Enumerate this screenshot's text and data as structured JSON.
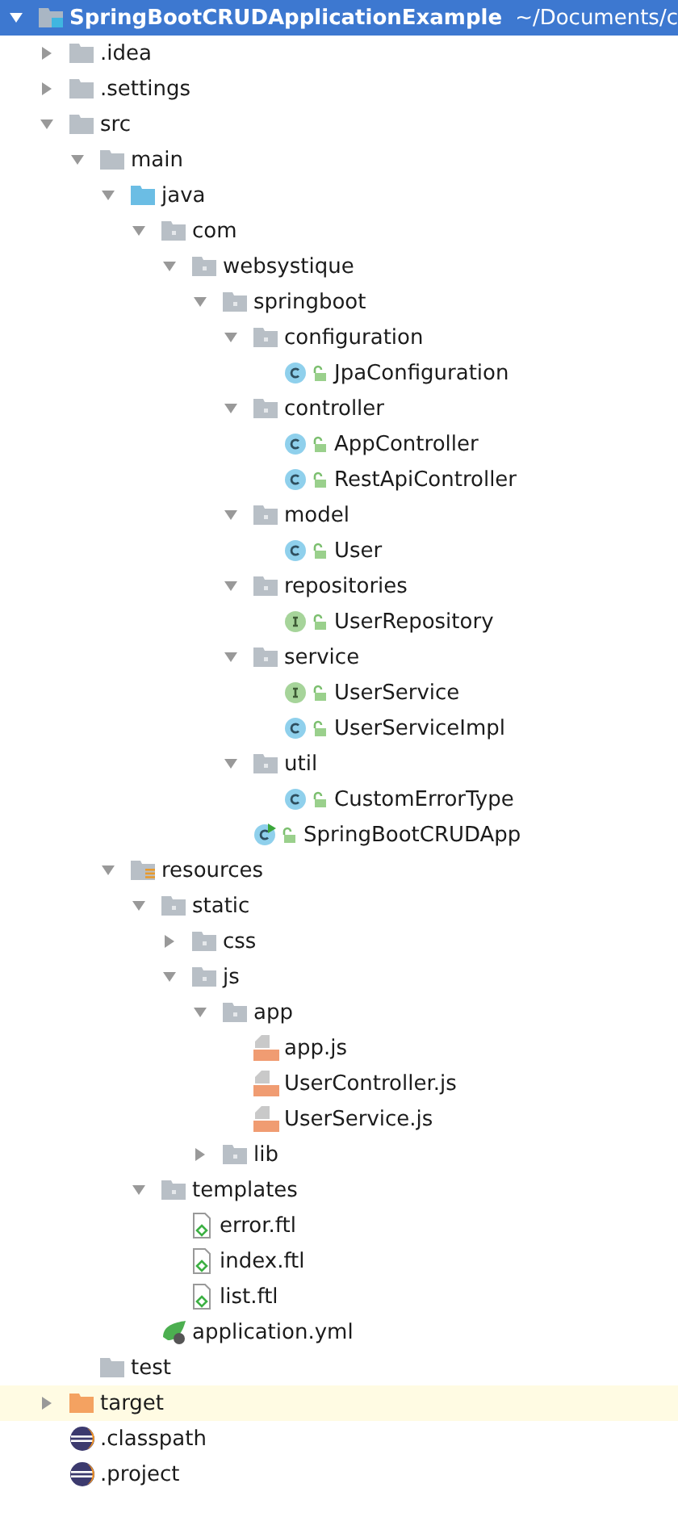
{
  "tree": [
    {
      "kind": "module",
      "name": "SpringBootCRUDApplicationExample",
      "path": "~/Documents/c",
      "selected": true,
      "expanded": true,
      "children": [
        {
          "kind": "folder",
          "name": ".idea",
          "selected": false,
          "expanded": false
        },
        {
          "kind": "folder",
          "name": ".settings",
          "selected": false,
          "expanded": false
        },
        {
          "kind": "folder",
          "name": "src",
          "selected": false,
          "expanded": true,
          "children": [
            {
              "kind": "folder",
              "name": "main",
              "selected": false,
              "expanded": true,
              "children": [
                {
                  "kind": "source-folder",
                  "name": "java",
                  "selected": false,
                  "expanded": true,
                  "children": [
                    {
                      "kind": "package",
                      "name": "com",
                      "selected": false,
                      "expanded": true,
                      "children": [
                        {
                          "kind": "package",
                          "name": "websystique",
                          "selected": false,
                          "expanded": true,
                          "children": [
                            {
                              "kind": "package",
                              "name": "springboot",
                              "selected": false,
                              "expanded": true,
                              "children": [
                                {
                                  "kind": "package",
                                  "name": "configuration",
                                  "selected": false,
                                  "expanded": true,
                                  "children": [
                                    {
                                      "kind": "class",
                                      "name": "JpaConfiguration",
                                      "selected": false
                                    }
                                  ]
                                },
                                {
                                  "kind": "package",
                                  "name": "controller",
                                  "selected": false,
                                  "expanded": true,
                                  "children": [
                                    {
                                      "kind": "class",
                                      "name": "AppController",
                                      "selected": false
                                    },
                                    {
                                      "kind": "class",
                                      "name": "RestApiController",
                                      "selected": false
                                    }
                                  ]
                                },
                                {
                                  "kind": "package",
                                  "name": "model",
                                  "selected": false,
                                  "expanded": true,
                                  "children": [
                                    {
                                      "kind": "class",
                                      "name": "User",
                                      "selected": false
                                    }
                                  ]
                                },
                                {
                                  "kind": "package",
                                  "name": "repositories",
                                  "selected": false,
                                  "expanded": true,
                                  "children": [
                                    {
                                      "kind": "interface",
                                      "name": "UserRepository",
                                      "selected": false
                                    }
                                  ]
                                },
                                {
                                  "kind": "package",
                                  "name": "service",
                                  "selected": false,
                                  "expanded": true,
                                  "children": [
                                    {
                                      "kind": "interface",
                                      "name": "UserService",
                                      "selected": false
                                    },
                                    {
                                      "kind": "class",
                                      "name": "UserServiceImpl",
                                      "selected": false
                                    }
                                  ]
                                },
                                {
                                  "kind": "package",
                                  "name": "util",
                                  "selected": false,
                                  "expanded": true,
                                  "children": [
                                    {
                                      "kind": "class",
                                      "name": "CustomErrorType",
                                      "selected": false
                                    }
                                  ]
                                },
                                {
                                  "kind": "spring-app",
                                  "name": "SpringBootCRUDApp",
                                  "selected": false
                                }
                              ]
                            }
                          ]
                        }
                      ]
                    }
                  ]
                },
                {
                  "kind": "resource-folder",
                  "name": "resources",
                  "selected": false,
                  "expanded": true,
                  "children": [
                    {
                      "kind": "package",
                      "name": "static",
                      "selected": false,
                      "expanded": true,
                      "children": [
                        {
                          "kind": "package",
                          "name": "css",
                          "selected": false,
                          "expanded": false
                        },
                        {
                          "kind": "package",
                          "name": "js",
                          "selected": false,
                          "expanded": true,
                          "children": [
                            {
                              "kind": "package",
                              "name": "app",
                              "selected": false,
                              "expanded": true,
                              "children": [
                                {
                                  "kind": "js",
                                  "name": "app.js",
                                  "selected": false
                                },
                                {
                                  "kind": "js",
                                  "name": "UserController.js",
                                  "selected": false
                                },
                                {
                                  "kind": "js",
                                  "name": "UserService.js",
                                  "selected": false
                                }
                              ]
                            },
                            {
                              "kind": "package",
                              "name": "lib",
                              "selected": false,
                              "expanded": false
                            }
                          ]
                        }
                      ]
                    },
                    {
                      "kind": "package",
                      "name": "templates",
                      "selected": false,
                      "expanded": true,
                      "children": [
                        {
                          "kind": "ftl",
                          "name": "error.ftl",
                          "selected": false
                        },
                        {
                          "kind": "ftl",
                          "name": "index.ftl",
                          "selected": false
                        },
                        {
                          "kind": "ftl",
                          "name": "list.ftl",
                          "selected": false
                        }
                      ]
                    },
                    {
                      "kind": "yml",
                      "name": "application.yml",
                      "selected": false
                    }
                  ]
                }
              ]
            },
            {
              "kind": "folder",
              "name": "test",
              "selected": false
            }
          ]
        },
        {
          "kind": "excluded-folder",
          "name": "target",
          "selected": false,
          "expanded": false
        },
        {
          "kind": "eclipse",
          "name": ".classpath",
          "selected": false
        },
        {
          "kind": "eclipse",
          "name": ".project",
          "selected": false
        }
      ]
    }
  ]
}
